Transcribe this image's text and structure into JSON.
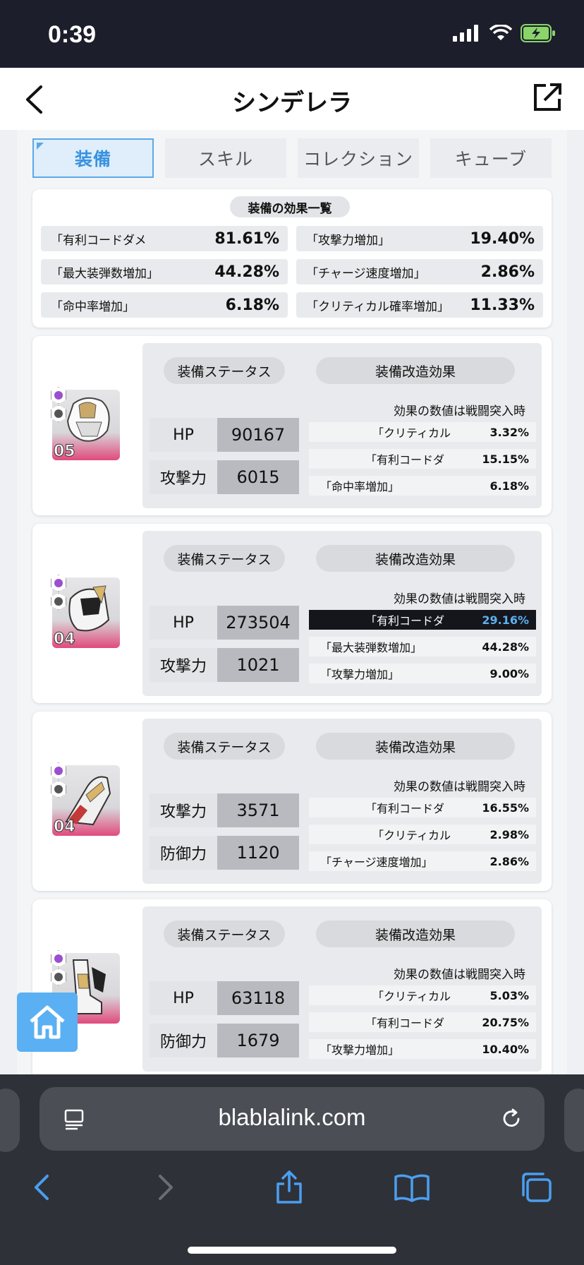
{
  "status_bar": {
    "time": "0:39"
  },
  "nav": {
    "title": "シンデレラ"
  },
  "tabs": [
    {
      "label": "装備",
      "active": true
    },
    {
      "label": "スキル",
      "active": false
    },
    {
      "label": "コレクション",
      "active": false
    },
    {
      "label": "キューブ",
      "active": false
    }
  ],
  "summary": {
    "heading": "装備の効果一覧",
    "rows": [
      {
        "label": "「有利コードダメ",
        "value": "81.61%"
      },
      {
        "label": "「攻撃力増加」",
        "value": "19.40%"
      },
      {
        "label": "「最大装弾数増加」",
        "value": "44.28%"
      },
      {
        "label": "「チャージ速度増加」",
        "value": "2.86%"
      },
      {
        "label": "「命中率増加」",
        "value": "6.18%"
      },
      {
        "label": "「クリティカル確率増加」",
        "value": "11.33%"
      }
    ]
  },
  "equipment": [
    {
      "level": "05",
      "status_label": "装備ステータス",
      "effect_label": "装備改造効果",
      "note": "効果の数値は戦闘突入時",
      "stats": [
        {
          "label": "HP",
          "value": "90167"
        },
        {
          "label": "攻撃力",
          "value": "6015"
        }
      ],
      "effects": [
        {
          "label": "「クリティカル",
          "value": "3.32%",
          "highlight": false
        },
        {
          "label": "「有利コードダ",
          "value": "15.15%",
          "highlight": false
        },
        {
          "label": "「命中率増加」",
          "value": "6.18%",
          "highlight": false
        }
      ]
    },
    {
      "level": "04",
      "status_label": "装備ステータス",
      "effect_label": "装備改造効果",
      "note": "効果の数値は戦闘突入時",
      "stats": [
        {
          "label": "HP",
          "value": "273504"
        },
        {
          "label": "攻撃力",
          "value": "1021"
        }
      ],
      "effects": [
        {
          "label": "「有利コードダ",
          "value": "29.16%",
          "highlight": true
        },
        {
          "label": "「最大装弾数増加」",
          "value": "44.28%",
          "highlight": false
        },
        {
          "label": "「攻撃力増加」",
          "value": "9.00%",
          "highlight": false
        }
      ]
    },
    {
      "level": "04",
      "status_label": "装備ステータス",
      "effect_label": "装備改造効果",
      "note": "効果の数値は戦闘突入時",
      "stats": [
        {
          "label": "攻撃力",
          "value": "3571"
        },
        {
          "label": "防御力",
          "value": "1120"
        }
      ],
      "effects": [
        {
          "label": "「有利コードダ",
          "value": "16.55%",
          "highlight": false
        },
        {
          "label": "「クリティカル",
          "value": "2.98%",
          "highlight": false
        },
        {
          "label": "「チャージ速度増加」",
          "value": "2.86%",
          "highlight": false
        }
      ]
    },
    {
      "level": "",
      "status_label": "装備ステータス",
      "effect_label": "装備改造効果",
      "note": "効果の数値は戦闘突入時",
      "stats": [
        {
          "label": "HP",
          "value": "63118"
        },
        {
          "label": "防御力",
          "value": "1679"
        }
      ],
      "effects": [
        {
          "label": "「クリティカル",
          "value": "5.03%",
          "highlight": false
        },
        {
          "label": "「有利コードダ",
          "value": "20.75%",
          "highlight": false
        },
        {
          "label": "「攻撃力増加」",
          "value": "10.40%",
          "highlight": false
        }
      ]
    }
  ],
  "browser": {
    "url": "blablalink.com"
  },
  "colors": {
    "accent": "#5aa9ea",
    "highlight_value": "#5db1f1",
    "rarity_pink": "#e04a7c",
    "home_button": "#5ab0f2"
  }
}
